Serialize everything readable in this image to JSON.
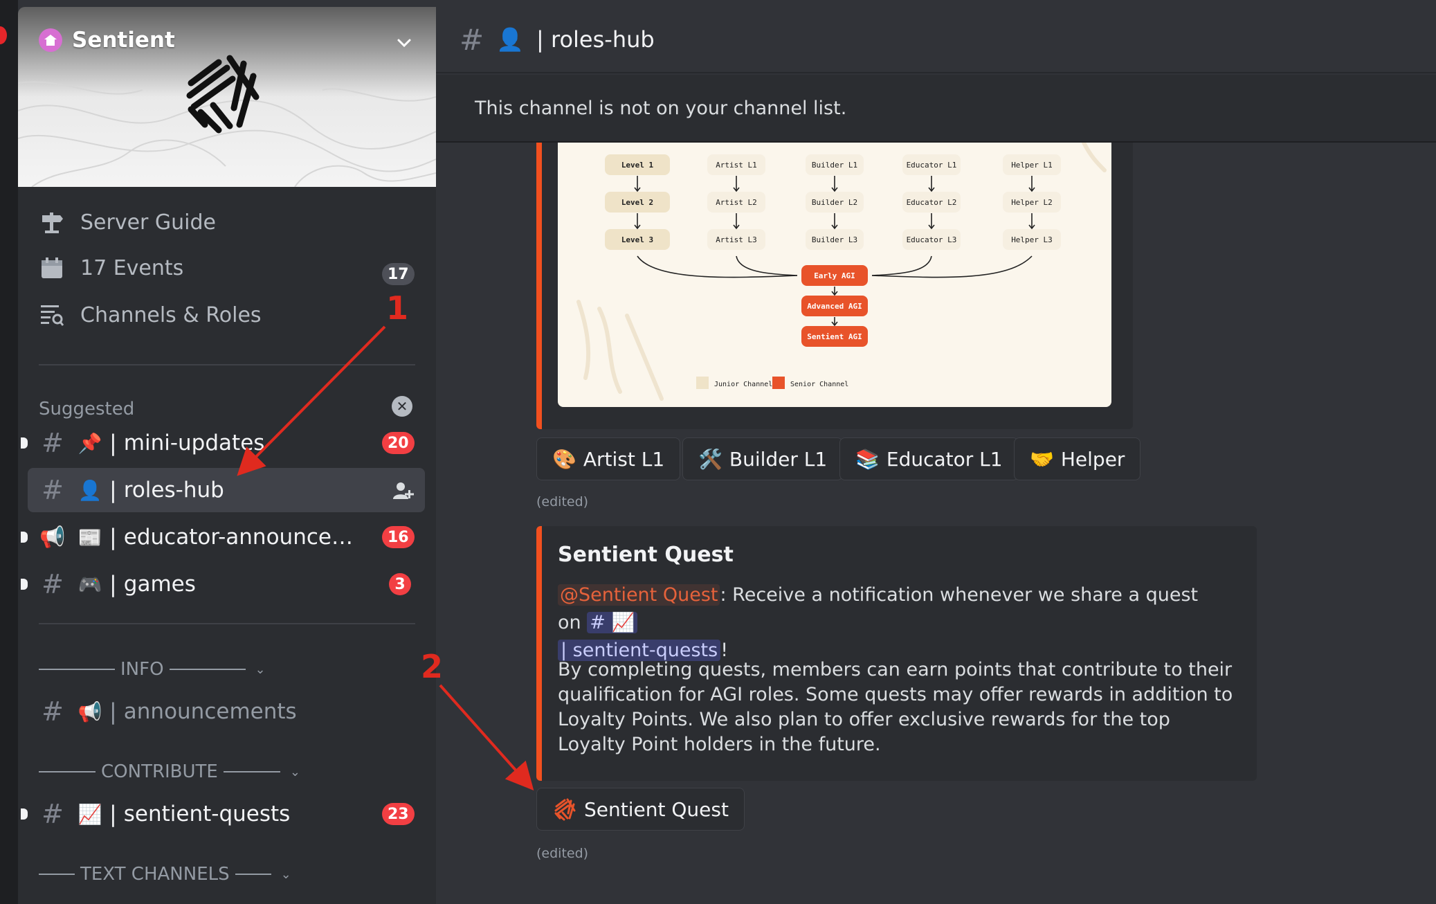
{
  "server": {
    "name": "Sentient"
  },
  "nav": {
    "server_guide": "Server Guide",
    "events": "17 Events",
    "events_count": "17",
    "channels_roles": "Channels & Roles"
  },
  "suggested": {
    "heading": "Suggested",
    "channels": [
      {
        "emoji": "📌",
        "name": "mini-updates",
        "badge": "20"
      },
      {
        "emoji": "👤",
        "name": "roles-hub"
      },
      {
        "emoji": "📰",
        "name": "educator-announcem...",
        "badge": "16"
      },
      {
        "emoji": "🎮",
        "name": "games",
        "badge": "3"
      }
    ]
  },
  "categories": {
    "info": "INFO",
    "contribute": "CONTRIBUTE",
    "text_channels": "TEXT CHANNELS"
  },
  "info_channels": [
    {
      "emoji": "📢",
      "name": "announcements"
    }
  ],
  "contribute_channels": [
    {
      "emoji": "📈",
      "name": "sentient-quests",
      "badge": "23"
    }
  ],
  "header": {
    "emoji": "👤",
    "channel": "| roles-hub"
  },
  "notice": "This channel is not on your channel list.",
  "diagram": {
    "col1": [
      "Level 1",
      "Level 2",
      "Level 3"
    ],
    "col2": [
      "Artist L1",
      "Artist L2",
      "Artist L3"
    ],
    "col3": [
      "Builder L1",
      "Builder L2",
      "Builder L3"
    ],
    "col4": [
      "Educator L1",
      "Educator L2",
      "Educator L3"
    ],
    "col5": [
      "Helper L1",
      "Helper L2",
      "Helper L3"
    ],
    "senior": [
      "Early AGI",
      "Advanced AGI",
      "Sentient AGI"
    ],
    "legend_junior": "Junior Channel",
    "legend_senior": "Senior Channel",
    "colors": {
      "junior": "#efe3c8",
      "senior": "#e8532a"
    }
  },
  "role_buttons": [
    {
      "emoji": "🎨",
      "label": "Artist L1"
    },
    {
      "emoji": "🛠️",
      "label": "Builder L1"
    },
    {
      "emoji": "📚",
      "label": "Educator L1"
    },
    {
      "emoji": "🤝",
      "label": "Helper"
    }
  ],
  "edited_label": "(edited)",
  "quest": {
    "title": "Sentient Quest",
    "mention": "@Sentient Quest",
    "line1_text": ": Receive a notification whenever we share a quest on",
    "channel_mention_hash": "# 📈",
    "channel_mention_name": "| sentient-quests",
    "line1_end": "!",
    "body": "By completing quests, members can earn points that contribute to their qualification for AGI roles. Some quests may offer rewards in addition to Loyalty Points. We also plan to offer exclusive rewards for the top Loyalty Point holders in the future.",
    "button_label": "Sentient Quest"
  },
  "annotations": {
    "one": "1",
    "two": "2"
  },
  "colors": {
    "accent": "#f2501f",
    "badge": "#f23f43",
    "annotation": "#e02a1f"
  }
}
